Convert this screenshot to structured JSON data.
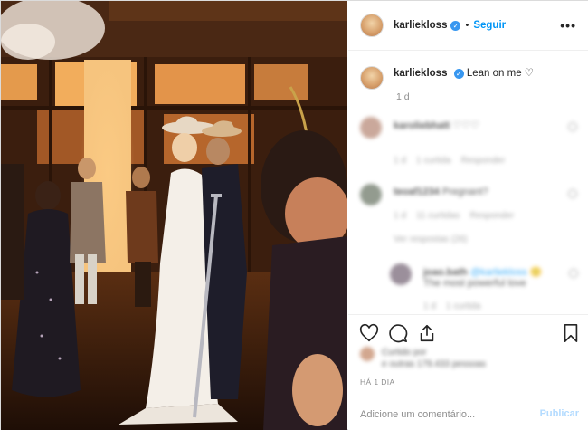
{
  "post": {
    "username": "karliekloss",
    "follow_label": "Seguir",
    "separator": "•",
    "more_label": "•••",
    "caption": {
      "username": "karliekloss",
      "text": "Lean on me ♡",
      "time": "1 d"
    },
    "comments": [
      {
        "username": "karoliebhatt",
        "text": "♡♡♡",
        "time": "1 d",
        "likes": "1 curtida",
        "reply": "Responder"
      },
      {
        "username": "teoaf1234",
        "text": "Pregnant?",
        "time": "1 d",
        "likes": "11 curtidas",
        "reply": "Responder"
      },
      {
        "view_replies": "Ver respostas (26)"
      },
      {
        "username": "joao.bath",
        "text": "@karliekloss 🙂",
        "sub": "The most powerful love",
        "time": "1 d",
        "likes": "1 curtida"
      }
    ],
    "liked_by": "Curtido por ",
    "liked_rest": "e outras",
    "liked_count_text": "e outras 179.433 pessoas",
    "timestamp": "HÁ 1 DIA",
    "add_comment_placeholder": "Adicione um comentário...",
    "publish_label": "Publicar"
  },
  "colors": {
    "accent": "#0095f6",
    "verified": "#3897f0",
    "publish_disabled": "#b3dbff",
    "muted": "#8e8e8e"
  },
  "icons": {
    "verified": "verified-badge-icon",
    "heart": "heart-icon",
    "comment": "comment-icon",
    "share": "share-icon",
    "save": "bookmark-icon",
    "more": "more-options-icon"
  }
}
